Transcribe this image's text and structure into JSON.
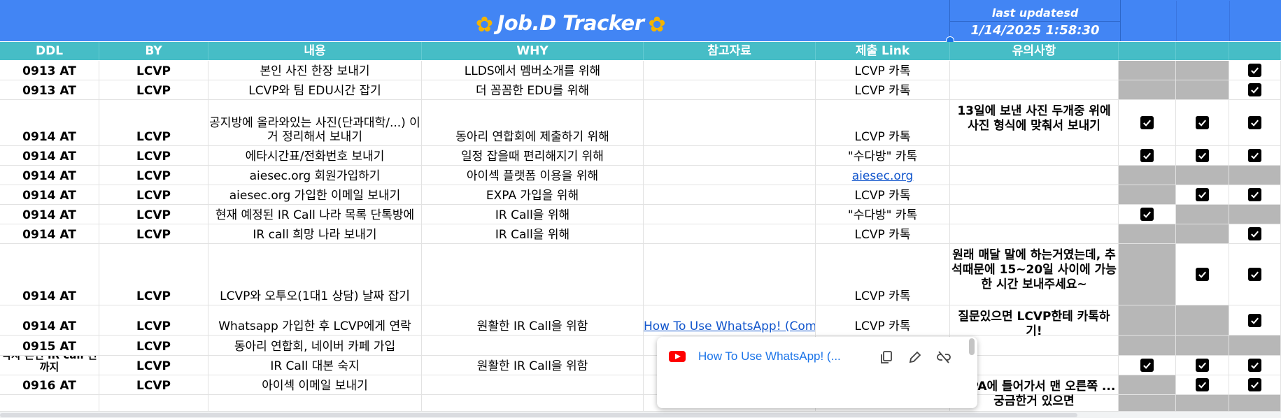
{
  "header": {
    "title": "Job.D Tracker",
    "swirl_left": "✿",
    "swirl_right": "✿",
    "last_updated_label": "last updatesd",
    "last_updated_value": "1/14/2025 1:58:30"
  },
  "columns": [
    "DDL",
    "BY",
    "내용",
    "WHY",
    "참고자료",
    "제출 Link",
    "유의사항"
  ],
  "rows": [
    {
      "ddl": "0913 AT",
      "by": "LCVP",
      "content": "본인 사진 한장 보내기",
      "why": "LLDS에서 멤버소개를 위해",
      "ref": "",
      "link": "LCVP 카톡",
      "note": "",
      "c1": "grey",
      "c2": "grey",
      "c3": "check"
    },
    {
      "ddl": "0913 AT",
      "by": "LCVP",
      "content": "LCVP와 팀 EDU시간 잡기",
      "why": "더 꼼꼼한 EDU를 위해",
      "ref": "",
      "link": "LCVP 카톡",
      "note": "",
      "c1": "grey",
      "c2": "grey",
      "c3": "check"
    },
    {
      "ddl": "0914 AT",
      "by": "LCVP",
      "content": "공지방에 올라와있는 사진(단과대학/...) 이거 정리해서 보내기",
      "why": "동아리 연합회에 제출하기 위해",
      "ref": "",
      "link": "LCVP 카톡",
      "note": "13일에 보낸 사진 두개중 위에 사진 형식에 맞춰서 보내기",
      "c1": "check",
      "c2": "check",
      "c3": "check"
    },
    {
      "ddl": "0914 AT",
      "by": "LCVP",
      "content": "에타시간표/전화번호 보내기",
      "why": "일정 잡을때 편리해지기 위해",
      "ref": "",
      "link": "\"수다방\" 카톡",
      "note": "",
      "c1": "check",
      "c2": "check",
      "c3": "check"
    },
    {
      "ddl": "0914 AT",
      "by": "LCVP",
      "content": "aiesec.org 회원가입하기",
      "why": "아이섹 플랫폼 이용을 위해",
      "ref": "",
      "link": "aiesec.org",
      "note": "",
      "c1": "grey",
      "c2": "grey",
      "c3": "grey"
    },
    {
      "ddl": "0914 AT",
      "by": "LCVP",
      "content": "aiesec.org 가입한 이메일 보내기",
      "why": "EXPA 가입을 위해",
      "ref": "",
      "link": "LCVP 카톡",
      "note": "",
      "c1": "grey",
      "c2": "check",
      "c3": "check"
    },
    {
      "ddl": "0914 AT",
      "by": "LCVP",
      "content": "현재 예정된 IR Call 나라 목록 단톡방에",
      "why": "IR Call을 위해",
      "ref": "",
      "link": "\"수다방\" 카톡",
      "note": "",
      "c1": "check",
      "c2": "grey",
      "c3": "grey"
    },
    {
      "ddl": "0914 AT",
      "by": "LCVP",
      "content": "IR call 희망 나라 보내기",
      "why": "IR Call을 위해",
      "ref": "",
      "link": "LCVP 카톡",
      "note": "",
      "c1": "grey",
      "c2": "grey",
      "c3": "check"
    },
    {
      "ddl": "0914 AT",
      "by": "LCVP",
      "content": "LCVP와 오투오(1대1 상담) 날짜 잡기",
      "why": "",
      "ref": "",
      "link": "LCVP 카톡",
      "note": "원래 매달 말에 하는거였는데, 추석때문에 15~20일 사이에 가능한 시간 보내주세요~",
      "c1": "grey",
      "c2": "check",
      "c3": "check"
    },
    {
      "ddl": "0914 AT",
      "by": "LCVP",
      "content": "Whatsapp 가입한 후 LCVP에게 연락",
      "why": "원활한 IR Call을 위함",
      "ref": "How To Use WhatsApp! (Comp",
      "link": "LCVP 카톡",
      "note": "질문있으면 LCVP한테 카톡하기!",
      "c1": "grey",
      "c2": "grey",
      "c3": "check"
    },
    {
      "ddl": "0915 AT",
      "by": "LCVP",
      "content": "동아리 연합회, 네이버 카페 가입",
      "why": "",
      "ref": "",
      "link": "",
      "note": "",
      "c1": "grey",
      "c2": "grey",
      "c3": "grey"
    },
    {
      "ddl": "각자 본인 IR call 전까지",
      "by": "LCVP",
      "content": "IR Call 대본 숙지",
      "why": "원활한 IR Call을 위함",
      "ref": "",
      "link": "",
      "note": "",
      "c1": "check",
      "c2": "check",
      "c3": "check"
    },
    {
      "ddl": "0916 AT",
      "by": "LCVP",
      "content": "아이섹 이메일 보내기",
      "why": "",
      "ref": "",
      "link": "",
      "note": "EXPA에 들어가서 맨 오른쪽 ... 궁금한거 있으면",
      "c1": "grey",
      "c2": "check",
      "c3": "check"
    },
    {
      "ddl": "",
      "by": "",
      "content": "",
      "why": "",
      "ref": "",
      "link": "",
      "note": "",
      "c1": "grey",
      "c2": "grey",
      "c3": "grey"
    }
  ],
  "popup": {
    "link_text": "How To Use WhatsApp! (...",
    "copy_icon": "copy-icon",
    "edit_icon": "pencil-icon",
    "unlink_icon": "unlink-icon"
  }
}
